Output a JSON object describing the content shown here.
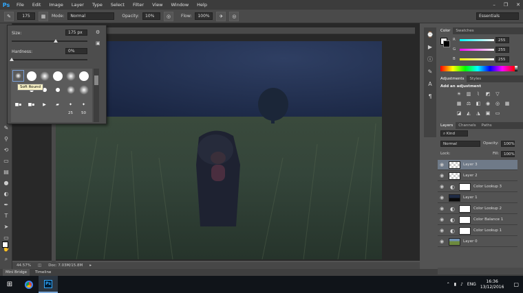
{
  "menubar": {
    "logo": "Ps",
    "items": [
      "File",
      "Edit",
      "Image",
      "Layer",
      "Type",
      "Select",
      "Filter",
      "View",
      "Window",
      "Help"
    ],
    "win_controls": [
      "–",
      "❐",
      "✕"
    ]
  },
  "options": {
    "brush_size": "175",
    "mode_label": "Mode:",
    "mode_value": "Normal",
    "opacity_label": "Opacity:",
    "opacity_value": "10%",
    "flow_label": "Flow:",
    "flow_value": "100%",
    "workspace": "Essentials"
  },
  "brush_picker": {
    "size_label": "Size:",
    "size_value": "175 px",
    "size_fraction": 0.58,
    "hardness_label": "Hardness:",
    "hardness_value": "0%",
    "hardness_fraction": 0.0,
    "tooltip": "Soft Round",
    "brush_numbers": [
      "25",
      "50"
    ]
  },
  "document": {
    "zoom": "44.57%",
    "doc_info": "Doc: 7.03M/15.8M"
  },
  "bottom_tabs": [
    "Mini Bridge",
    "Timeline"
  ],
  "color_panel": {
    "tabs": [
      "Color",
      "Swatches"
    ],
    "r_label": "R",
    "r_value": "255",
    "g_label": "G",
    "g_value": "255",
    "b_label": "B",
    "b_value": "255"
  },
  "adjustments_panel": {
    "tabs": [
      "Adjustments",
      "Styles"
    ],
    "heading": "Add an adjustment"
  },
  "layers_panel": {
    "tabs": [
      "Layers",
      "Channels",
      "Paths"
    ],
    "kind_label": "Kind",
    "blend_mode": "Normal",
    "opacity_label": "Opacity:",
    "opacity_value": "100%",
    "lock_label": "Lock:",
    "fill_label": "Fill:",
    "fill_value": "100%",
    "layers": [
      {
        "name": "Layer 3",
        "thumb": "checker",
        "selected": true
      },
      {
        "name": "Layer 2",
        "thumb": "checker",
        "selected": false
      },
      {
        "name": "Color Lookup 3",
        "thumb": "white",
        "selected": false
      },
      {
        "name": "Layer 1",
        "thumb": "photo-dark",
        "selected": false
      },
      {
        "name": "Color Lookup 2",
        "thumb": "white",
        "selected": false
      },
      {
        "name": "Color Balance 1",
        "thumb": "white",
        "selected": false
      },
      {
        "name": "Color Lookup 1",
        "thumb": "white",
        "selected": false
      },
      {
        "name": "Layer 0",
        "thumb": "photo",
        "selected": false
      }
    ]
  },
  "taskbar": {
    "language": "ENG",
    "time": "16:36",
    "date": "13/12/2016"
  }
}
